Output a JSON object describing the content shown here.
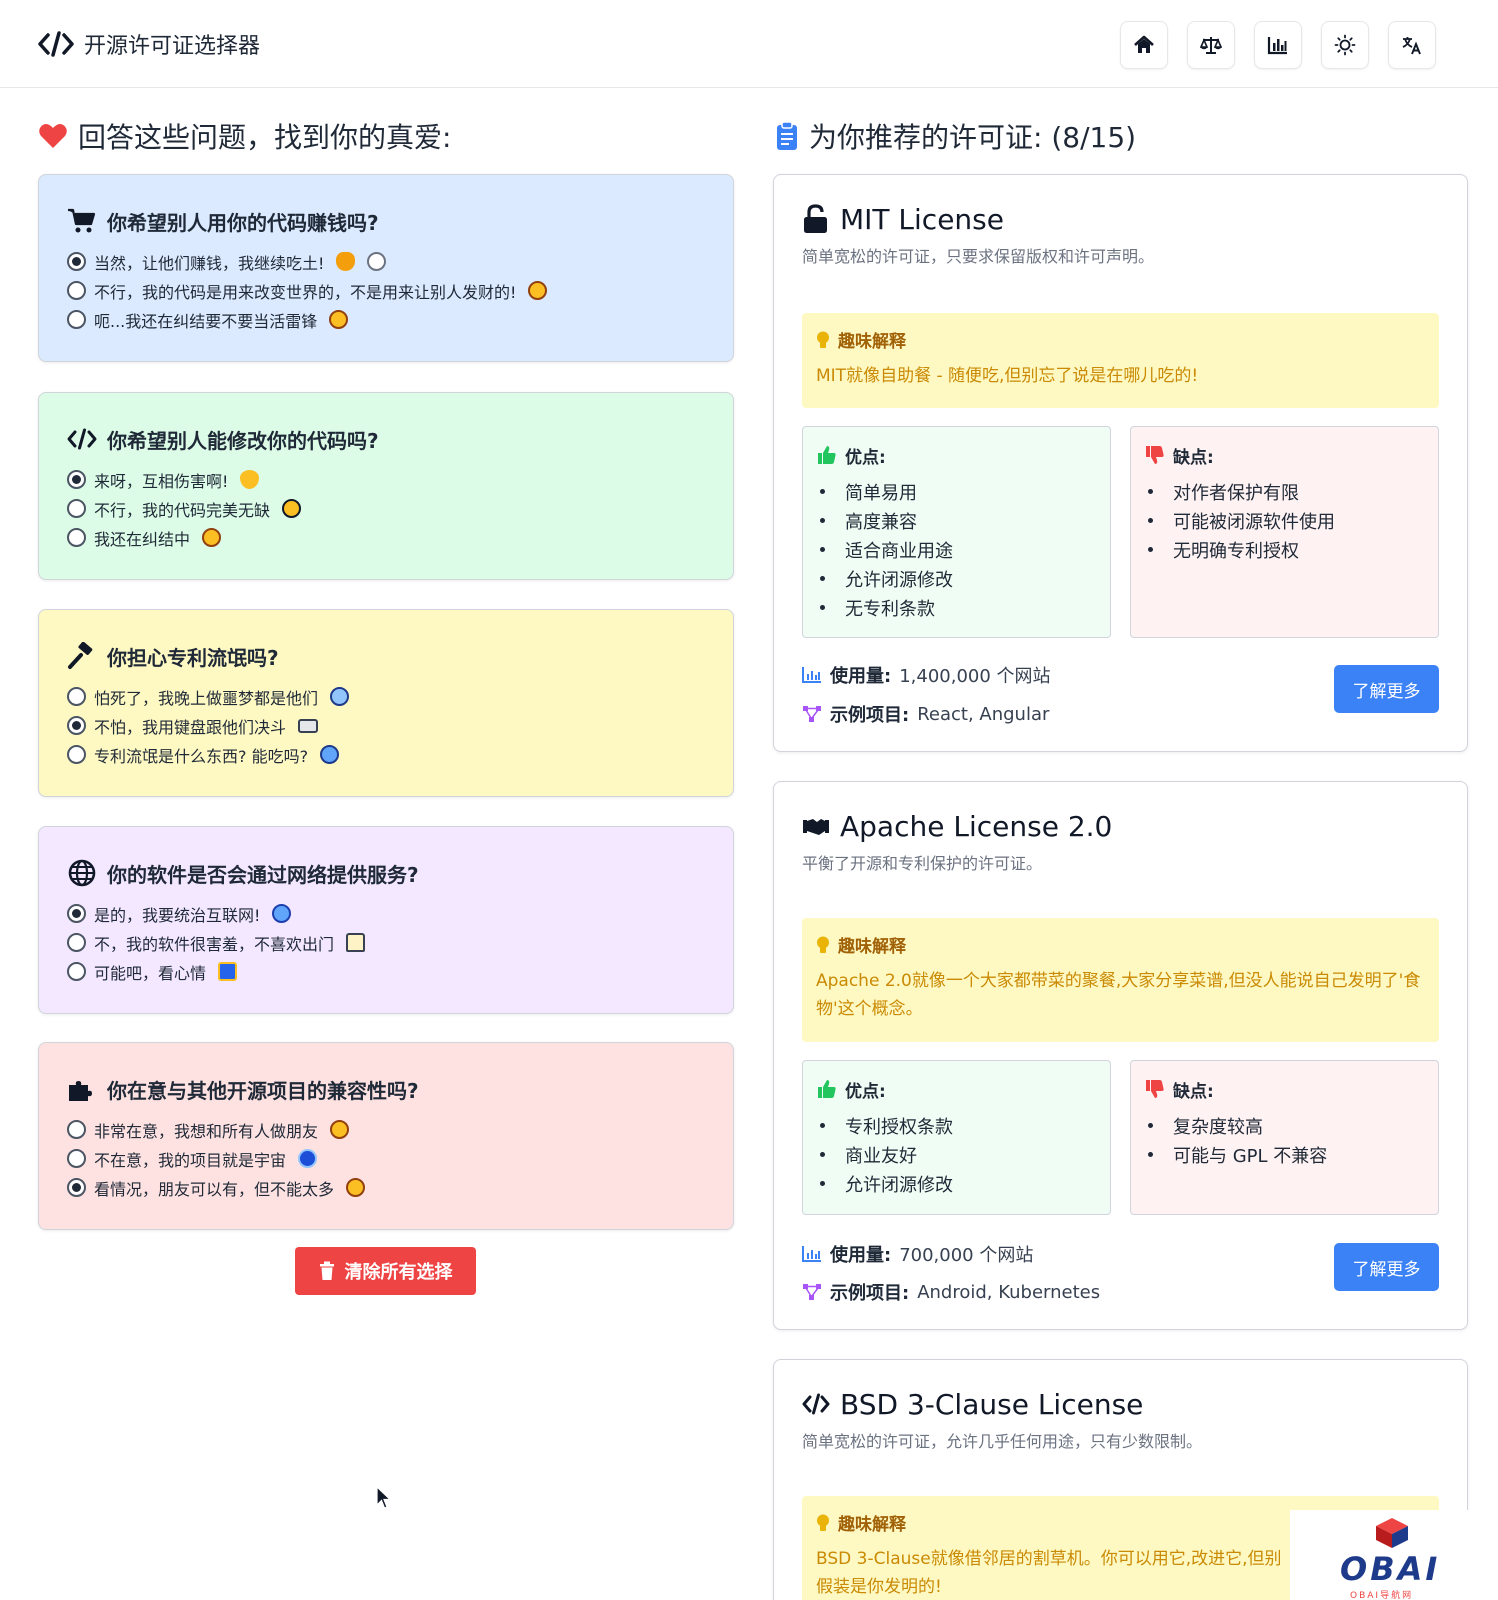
{
  "header": {
    "title": "开源许可证选择器",
    "nav": [
      {
        "icon": "home-icon"
      },
      {
        "icon": "scale-icon"
      },
      {
        "icon": "chart-icon"
      },
      {
        "icon": "sun-icon"
      },
      {
        "icon": "translate-icon"
      }
    ]
  },
  "left": {
    "title": "回答这些问题，找到你的真爱:",
    "questions": [
      {
        "title": "你希望别人用你的代码赚钱吗?",
        "icon": "cart-icon",
        "options": [
          {
            "label": "当然，让他们赚钱，我继续吃土!",
            "selected": true
          },
          {
            "label": "不行，我的代码是用来改变世界的，不是用来让别人发财的!",
            "selected": false
          },
          {
            "label": "呃...我还在纠结要不要当活雷锋",
            "selected": false
          }
        ]
      },
      {
        "title": "你希望别人能修改你的代码吗?",
        "icon": "code-icon",
        "options": [
          {
            "label": "来呀，互相伤害啊!",
            "selected": true
          },
          {
            "label": "不行，我的代码完美无缺",
            "selected": false
          },
          {
            "label": "我还在纠结中",
            "selected": false
          }
        ]
      },
      {
        "title": "你担心专利流氓吗?",
        "icon": "gavel-icon",
        "options": [
          {
            "label": "怕死了，我晚上做噩梦都是他们",
            "selected": false
          },
          {
            "label": "不怕，我用键盘跟他们决斗",
            "selected": true
          },
          {
            "label": "专利流氓是什么东西? 能吃吗?",
            "selected": false
          }
        ]
      },
      {
        "title": "你的软件是否会通过网络提供服务?",
        "icon": "globe-icon",
        "options": [
          {
            "label": "是的，我要统治互联网!",
            "selected": true
          },
          {
            "label": "不，我的软件很害羞，不喜欢出门",
            "selected": false
          },
          {
            "label": "可能吧，看心情",
            "selected": false
          }
        ]
      },
      {
        "title": "你在意与其他开源项目的兼容性吗?",
        "icon": "puzzle-icon",
        "options": [
          {
            "label": "非常在意，我想和所有人做朋友",
            "selected": false
          },
          {
            "label": "不在意，我的项目就是宇宙",
            "selected": false
          },
          {
            "label": "看情况，朋友可以有，但不能太多",
            "selected": true
          }
        ]
      }
    ],
    "clear_label": "清除所有选择"
  },
  "right": {
    "title": "为你推荐的许可证: (8/15)",
    "fun_label": "趣味解释",
    "pros_label": "优点:",
    "cons_label": "缺点:",
    "usage_label": "使用量:",
    "examples_label": "示例项目:",
    "more_label": "了解更多",
    "licenses": [
      {
        "name": "MIT License",
        "icon": "unlock-icon",
        "desc": "简单宽松的许可证，只要求保留版权和许可声明。",
        "fun": "MIT就像自助餐 - 随便吃,但别忘了说是在哪儿吃的!",
        "pros": [
          "简单易用",
          "高度兼容",
          "适合商业用途",
          "允许闭源修改",
          "无专利条款"
        ],
        "cons": [
          "对作者保护有限",
          "可能被闭源软件使用",
          "无明确专利授权"
        ],
        "usage": "1,400,000 个网站",
        "examples": "React, Angular"
      },
      {
        "name": "Apache License 2.0",
        "icon": "handshake-icon",
        "desc": "平衡了开源和专利保护的许可证。",
        "fun": "Apache 2.0就像一个大家都带菜的聚餐,大家分享菜谱,但没人能说自己发明了'食物'这个概念。",
        "pros": [
          "专利授权条款",
          "商业友好",
          "允许闭源修改"
        ],
        "cons": [
          "复杂度较高",
          "可能与 GPL 不兼容"
        ],
        "usage": "700,000 个网站",
        "examples": "Android, Kubernetes"
      },
      {
        "name": "BSD 3-Clause License",
        "icon": "code-icon",
        "desc": "简单宽松的许可证，允许几乎任何用途，只有少数限制。",
        "fun": "BSD 3-Clause就像借邻居的割草机。你可以用它,改进它,但别假装是你发明的!"
      }
    ]
  },
  "watermark": {
    "text": "OBAI",
    "sub": "OBAI导航网"
  },
  "colors": {
    "accent": "#3b82f6",
    "danger": "#ef4444",
    "fun_bg": "#fef9c3"
  }
}
